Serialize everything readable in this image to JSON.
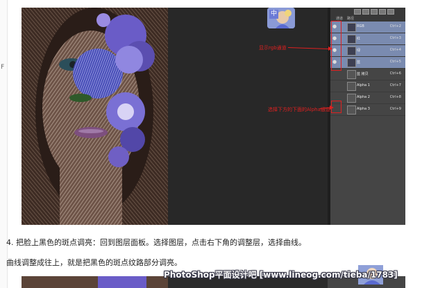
{
  "page": {
    "gutter_mark": "F",
    "step_text": "4. 把脸上黑色的斑点调亮：回到图层面板。选择图层，点击右下角的调整层，选择曲线。",
    "curve_text": "曲线调整成往上，就是把黑色的斑点纹路部分调亮。"
  },
  "photoshop": {
    "thumbnail_badge": "中",
    "layers_panel": {
      "tabs": [
        "通道",
        "路径"
      ],
      "rows": [
        {
          "name": "RGB",
          "shortcut": "Ctrl+2",
          "selected": true,
          "visible": true
        },
        {
          "name": "红",
          "shortcut": "Ctrl+3",
          "selected": true,
          "visible": true
        },
        {
          "name": "绿",
          "shortcut": "Ctrl+4",
          "selected": true,
          "visible": true
        },
        {
          "name": "蓝",
          "shortcut": "Ctrl+5",
          "selected": true,
          "visible": true
        },
        {
          "name": "蓝 拷贝",
          "shortcut": "Ctrl+6",
          "selected": false,
          "visible": false
        },
        {
          "name": "Alpha 1",
          "shortcut": "Ctrl+7",
          "selected": false,
          "visible": false
        },
        {
          "name": "Alpha 2",
          "shortcut": "Ctrl+8",
          "selected": false,
          "visible": false
        },
        {
          "name": "Alpha 3",
          "shortcut": "Ctrl+9",
          "selected": false,
          "visible": false
        }
      ]
    },
    "annotations": {
      "rgb_note": "显示rgb通道",
      "alpha_note": "选择下方的下面的Alpha通道"
    }
  },
  "watermark": "PhotoShop平面设计吧 [www.lineog.com/tieba/1783]",
  "colors": {
    "annotation_red": "#e02020",
    "selected_layer": "#7a8bb0",
    "panel_bg": "#454545"
  }
}
